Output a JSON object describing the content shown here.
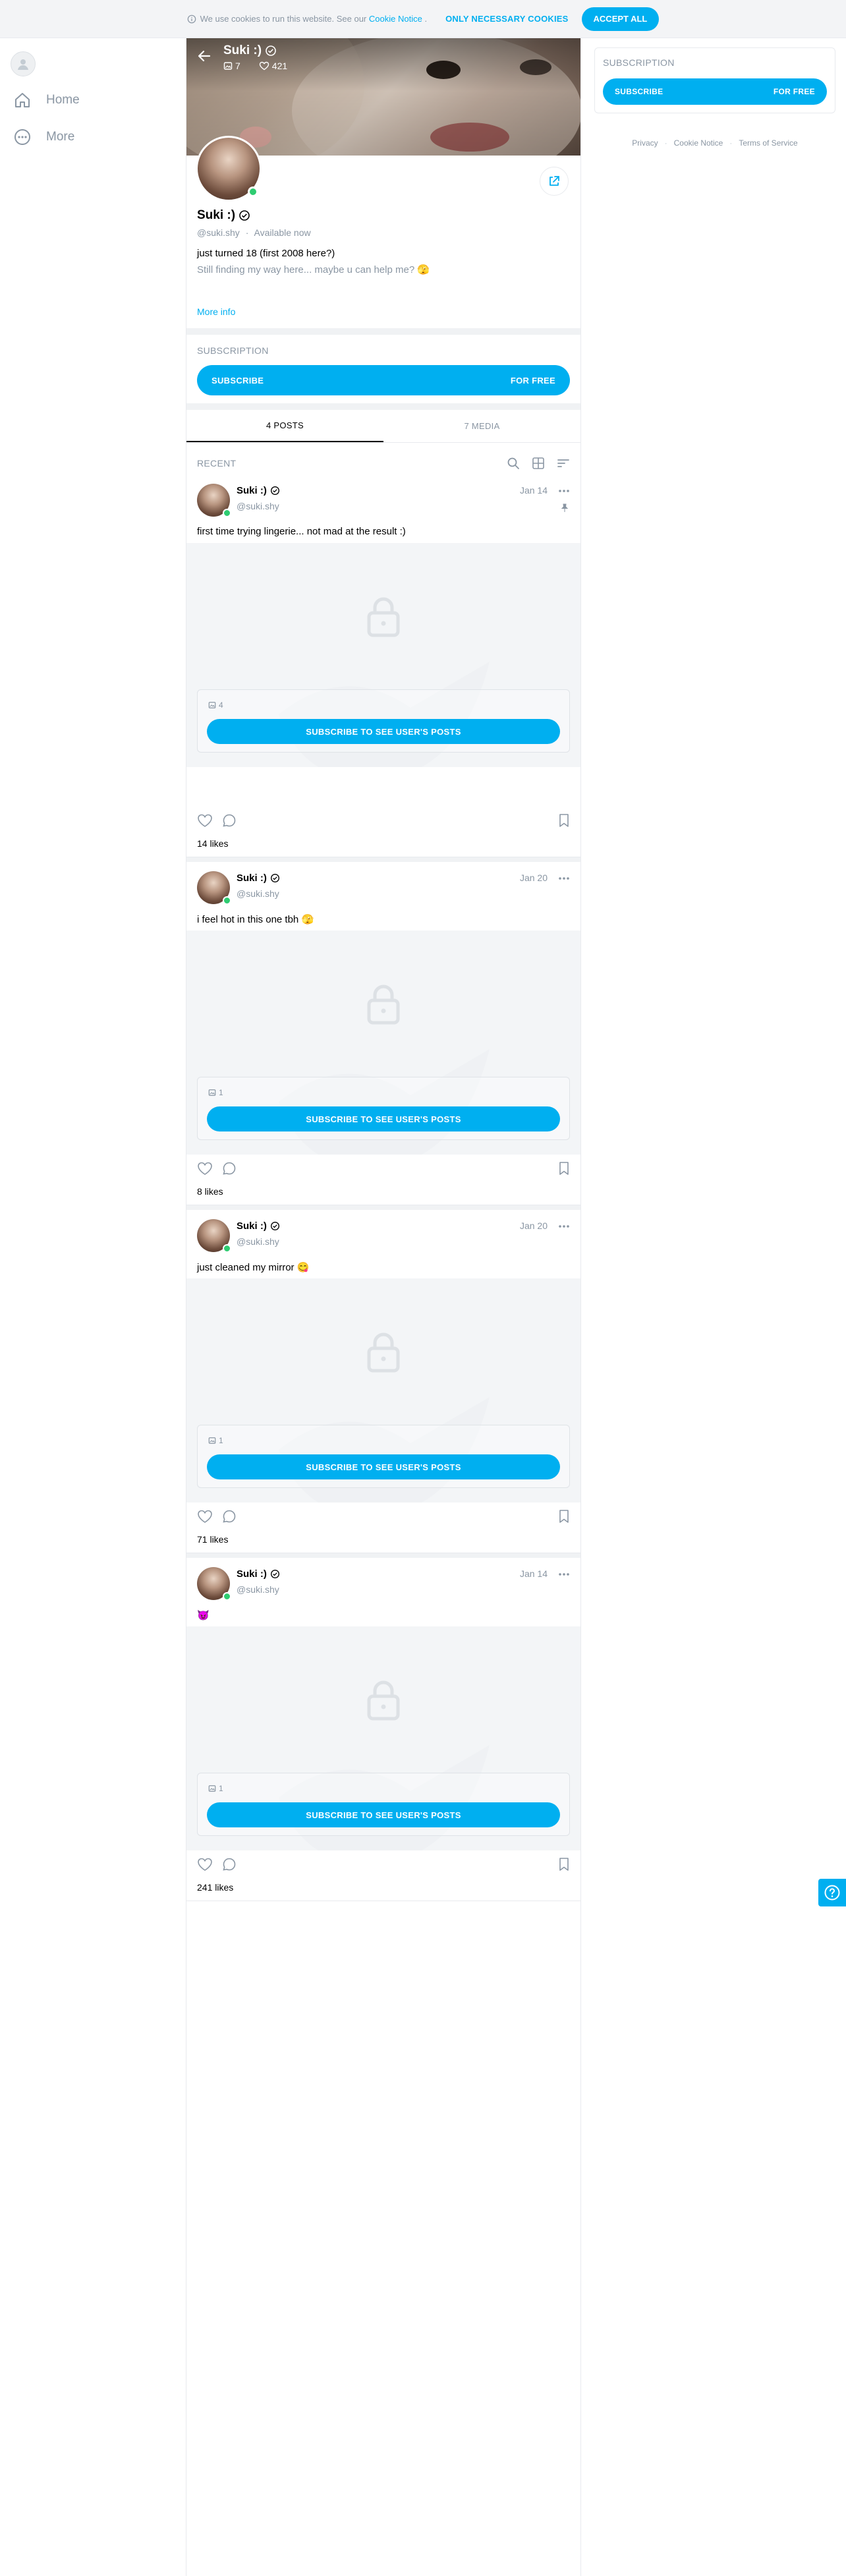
{
  "cookie": {
    "text": "We use cookies to run this website. See our",
    "link": "Cookie Notice",
    "period": ".",
    "necessary_btn": "ONLY NECESSARY COOKIES",
    "accept_btn": "ACCEPT ALL"
  },
  "sidebar": {
    "items": [
      {
        "label": "Home",
        "icon": "home-icon"
      },
      {
        "label": "More",
        "icon": "more-icon"
      }
    ]
  },
  "profile": {
    "name": "Suki :)",
    "posts_count": "7",
    "likes_count": "421",
    "handle": "@suki.shy",
    "status_sep": "·",
    "status": "Available now",
    "bio_line1": "just turned 18 (first 2008 here?)",
    "bio_line2": "Still finding my way here... maybe u can help me? 🫣",
    "more_info": "More info"
  },
  "subscription": {
    "label": "SUBSCRIPTION",
    "button_left": "SUBSCRIBE",
    "button_right": "FOR FREE"
  },
  "tabs": [
    {
      "label": "4 POSTS",
      "active": true
    },
    {
      "label": "7 MEDIA",
      "active": false
    }
  ],
  "recent_label": "RECENT",
  "posts": [
    {
      "name": "Suki :)",
      "handle": "@suki.shy",
      "date": "Jan 14",
      "text": "first time trying lingerie... not mad at the result :)",
      "media_count": "4",
      "cta": "SUBSCRIBE TO SEE USER'S POSTS",
      "likes": "14 likes",
      "pinned": true
    },
    {
      "name": "Suki :)",
      "handle": "@suki.shy",
      "date": "Jan 20",
      "text": "i feel hot in this one tbh 🫣",
      "media_count": "1",
      "cta": "SUBSCRIBE TO SEE USER'S POSTS",
      "likes": "8 likes",
      "pinned": false
    },
    {
      "name": "Suki :)",
      "handle": "@suki.shy",
      "date": "Jan 20",
      "text": "just cleaned my mirror 😋",
      "media_count": "1",
      "cta": "SUBSCRIBE TO SEE USER'S POSTS",
      "likes": "71 likes",
      "pinned": false
    },
    {
      "name": "Suki :)",
      "handle": "@suki.shy",
      "date": "Jan 14",
      "text": "😈",
      "media_count": "1",
      "cta": "SUBSCRIBE TO SEE USER'S POSTS",
      "likes": "241 likes",
      "pinned": false
    }
  ],
  "right": {
    "title": "SUBSCRIPTION",
    "button_left": "SUBSCRIBE",
    "button_right": "FOR FREE",
    "footer": [
      "Privacy",
      "Cookie Notice",
      "Terms of Service"
    ],
    "footer_sep": "·"
  },
  "colors": {
    "accent": "#00aff0",
    "online": "#2ecc71",
    "muted": "#8a96a3"
  }
}
